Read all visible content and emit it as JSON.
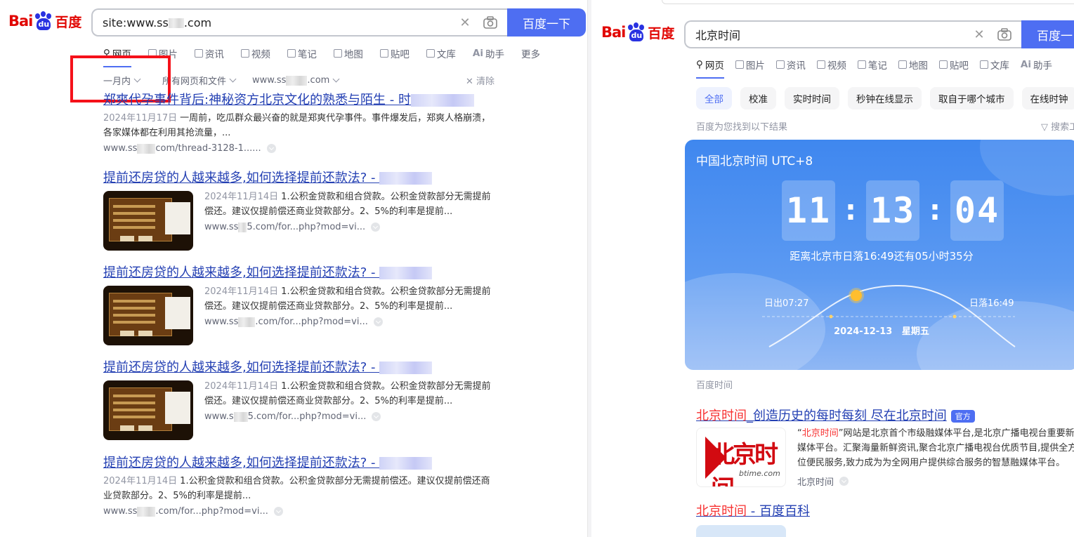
{
  "brand": {
    "bai": "Bai",
    "paw": "du",
    "du": "百度"
  },
  "left": {
    "query": "site:www.ss",
    "query_suffix": ".com",
    "search_button": "百度一下",
    "tabs": [
      {
        "label": "网页",
        "active": true
      },
      {
        "label": "图片"
      },
      {
        "label": "资讯"
      },
      {
        "label": "视频"
      },
      {
        "label": "笔记"
      },
      {
        "label": "地图"
      },
      {
        "label": "贴吧"
      },
      {
        "label": "文库"
      },
      {
        "label": "助手"
      },
      {
        "label": "更多"
      }
    ],
    "filters": {
      "time": "一月内",
      "type": "所有网页和文件",
      "site_prefix": "www.ss",
      "site_suffix": ".com",
      "clear": "清除"
    },
    "results": [
      {
        "title": "郑爽代孕事件背后:神秘资方北京文化的熟悉与陌生 - 时",
        "date": "2024年11月17日",
        "desc": "一周前，吃瓜群众最兴奋的就是郑爽代孕事件。事件爆发后，郑爽人格崩溃，各家媒体都在利用其抢流量，...",
        "src_prefix": "www.ss",
        "src_suffix": "com/thread-3128-1......"
      },
      {
        "title": "提前还房贷的人越来越多,如何选择提前还款法? - ",
        "date": "2024年11月14日",
        "desc": "1.公积金贷款和组合贷款。公积金贷款部分无需提前偿还。建议仅提前偿还商业贷款部分。2、5%的利率是提前...",
        "src_prefix": "www.ss",
        "src_suffix": "5.com/for...php?mod=vi..."
      },
      {
        "title": "提前还房贷的人越来越多,如何选择提前还款法? - ",
        "date": "2024年11月14日",
        "desc": "1.公积金贷款和组合贷款。公积金贷款部分无需提前偿还。建议仅提前偿还商业贷款部分。2、5%的利率是提前...",
        "src_prefix": "www.ss",
        "src_suffix": ".com/for...php?mod=vi..."
      },
      {
        "title": "提前还房贷的人越来越多,如何选择提前还款法? - ",
        "date": "2024年11月14日",
        "desc": "1.公积金贷款和组合贷款。公积金贷款部分无需提前偿还。建议仅提前偿还商业贷款部分。2、5%的利率是提前...",
        "src_prefix": "www.s",
        "src_suffix": "5.com/for...php?mod=vi..."
      },
      {
        "title": "提前还房贷的人越来越多,如何选择提前还款法? - ",
        "date": "2024年11月14日",
        "desc": "1.公积金贷款和组合贷款。公积金贷款部分无需提前偿还。建议仅提前偿还商业贷款部分。2、5%的利率是提前...",
        "src_prefix": "www.ss",
        "src_suffix": ".com/for...php?mod=vi..."
      }
    ]
  },
  "right": {
    "query": "北京时间",
    "search_button": "百度一",
    "tabs": [
      {
        "label": "网页",
        "active": true
      },
      {
        "label": "图片"
      },
      {
        "label": "资讯"
      },
      {
        "label": "视频"
      },
      {
        "label": "笔记"
      },
      {
        "label": "地图"
      },
      {
        "label": "贴吧"
      },
      {
        "label": "文库"
      },
      {
        "label": "助手"
      }
    ],
    "chips": [
      "全部",
      "校准",
      "实时时间",
      "秒钟在线显示",
      "取自于哪个城市",
      "在线时钟"
    ],
    "found": "百度为您找到以下结果",
    "search_tools": "搜索工",
    "time_card": {
      "title": "中国北京时间 UTC+8",
      "hours": "11",
      "minutes": "13",
      "seconds": "04",
      "sunset_remaining": "距离北京市日落16:49还有05小时35分",
      "sunrise": "日出07:27",
      "sunset": "日落16:49",
      "date": "2024-12-13   星期五"
    },
    "source_label": "百度时间",
    "result2": {
      "title_kw": "北京时间",
      "title_rest": "_创造历史的每时每刻 尽在北京时间",
      "badge": "官方",
      "logo_cn": "北京时间",
      "logo_en": "btime.com",
      "desc_q1": "“",
      "desc_kw": "北京时间",
      "desc_rest": "”网站是北京首个市级融媒体平台,是北京广播电视台重要新媒体平台。汇聚海量新鲜资讯,聚合北京广播电视台优质节目,提供全方位便民服务,致力成为为全网用户提供综合服务的智慧融媒体平台。",
      "src": "北京时间"
    },
    "result3": {
      "title_kw": "北京时间",
      "title_rest": " - 百度百科"
    }
  },
  "colors": {
    "brand_blue": "#4e6ef2",
    "link": "#2440b3",
    "keyword_red": "#f73131",
    "highlight_box": "#f5111a"
  }
}
